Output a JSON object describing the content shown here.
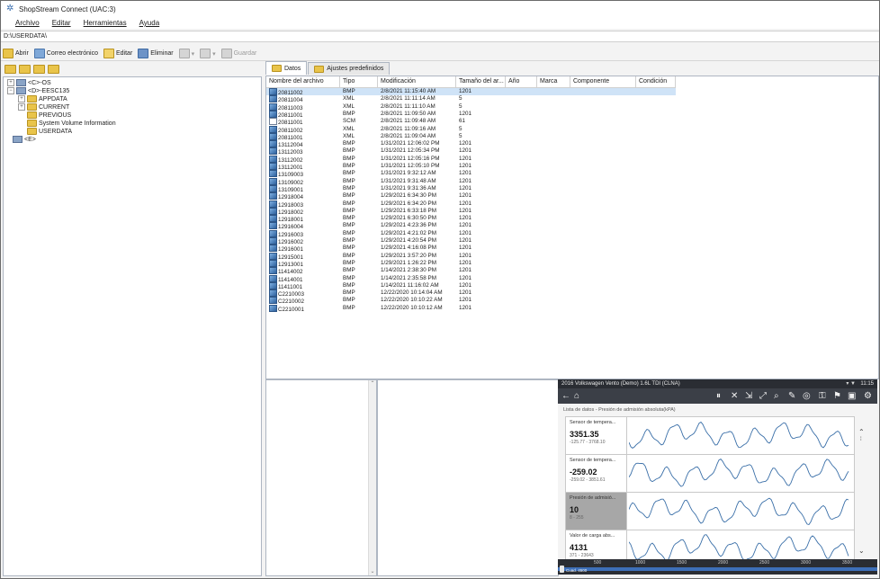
{
  "window": {
    "title": "ShopStream Connect (UAC:3)"
  },
  "menu": [
    "Archivo",
    "Editar",
    "Herramientas",
    "Ayuda"
  ],
  "path": "D:\\USERDATA\\",
  "toolbar": {
    "open": "Abrir",
    "email": "Correo electrónico",
    "edit": "Editar",
    "delete": "Eliminar",
    "save": "Guardar"
  },
  "tree": {
    "nodes": [
      "<C>-OS",
      "<D>-EESC135",
      "APPDATA",
      "CURRENT",
      "PREVIOUS",
      "System Volume Information",
      "USERDATA",
      "<E>"
    ]
  },
  "tabs": [
    "Datos",
    "Ajustes predefinidos"
  ],
  "files": {
    "columns": [
      "Nombre del archivo",
      "Tipo",
      "Modificación",
      "Tamaño del ar...",
      "Año",
      "Marca",
      "Componente",
      "Condición"
    ],
    "rows": [
      [
        "20811002",
        "BMP",
        "2/8/2021 11:15:40 AM",
        "1201"
      ],
      [
        "20811004",
        "XML",
        "2/8/2021 11:11:14 AM",
        "5"
      ],
      [
        "20811003",
        "XML",
        "2/8/2021 11:11:10 AM",
        "5"
      ],
      [
        "20811001",
        "BMP",
        "2/8/2021 11:09:50 AM",
        "1201"
      ],
      [
        "20811001",
        "SCM",
        "2/8/2021 11:09:48 AM",
        "61"
      ],
      [
        "20811002",
        "XML",
        "2/8/2021 11:09:16 AM",
        "5"
      ],
      [
        "20811001",
        "XML",
        "2/8/2021 11:09:04 AM",
        "5"
      ],
      [
        "13112004",
        "BMP",
        "1/31/2021 12:06:02 PM",
        "1201"
      ],
      [
        "13112003",
        "BMP",
        "1/31/2021 12:05:34 PM",
        "1201"
      ],
      [
        "13112002",
        "BMP",
        "1/31/2021 12:05:16 PM",
        "1201"
      ],
      [
        "13112001",
        "BMP",
        "1/31/2021 12:05:10 PM",
        "1201"
      ],
      [
        "13109003",
        "BMP",
        "1/31/2021 9:32:12 AM",
        "1201"
      ],
      [
        "13109002",
        "BMP",
        "1/31/2021 9:31:48 AM",
        "1201"
      ],
      [
        "13109001",
        "BMP",
        "1/31/2021 9:31:36 AM",
        "1201"
      ],
      [
        "12918004",
        "BMP",
        "1/29/2021 6:34:30 PM",
        "1201"
      ],
      [
        "12918003",
        "BMP",
        "1/29/2021 6:34:20 PM",
        "1201"
      ],
      [
        "12918002",
        "BMP",
        "1/29/2021 6:33:18 PM",
        "1201"
      ],
      [
        "12918001",
        "BMP",
        "1/29/2021 6:30:50 PM",
        "1201"
      ],
      [
        "12916004",
        "BMP",
        "1/29/2021 4:23:36 PM",
        "1201"
      ],
      [
        "12916003",
        "BMP",
        "1/29/2021 4:21:02 PM",
        "1201"
      ],
      [
        "12916002",
        "BMP",
        "1/29/2021 4:20:54 PM",
        "1201"
      ],
      [
        "12916001",
        "BMP",
        "1/29/2021 4:16:08 PM",
        "1201"
      ],
      [
        "12915001",
        "BMP",
        "1/29/2021 3:57:20 PM",
        "1201"
      ],
      [
        "12913001",
        "BMP",
        "1/29/2021 1:26:22 PM",
        "1201"
      ],
      [
        "11414002",
        "BMP",
        "1/14/2021 2:38:30 PM",
        "1201"
      ],
      [
        "11414001",
        "BMP",
        "1/14/2021 2:35:58 PM",
        "1201"
      ],
      [
        "11411001",
        "BMP",
        "1/14/2021 11:16:02 AM",
        "1201"
      ],
      [
        "C2210003",
        "BMP",
        "12/22/2020 10:14:04 AM",
        "1201"
      ],
      [
        "C2210002",
        "BMP",
        "12/22/2020 10:10:22 AM",
        "1201"
      ],
      [
        "C2210001",
        "BMP",
        "12/22/2020 10:10:12 AM",
        "1201"
      ]
    ]
  },
  "device": {
    "header": "2016 Volkswagen Vento (Demo) 1.6L TDI (CLNA)",
    "clock": "11:15",
    "subtitle": "Lista de datos - Presión de admisión absoluta(kPA)",
    "tracks": [
      {
        "name": "Sensor de tempera...",
        "value": "3351.35",
        "range": "-125.77 - 3768.10"
      },
      {
        "name": "Sensor de tempera...",
        "value": "-259.02",
        "range": "-259.02 - 3851.61"
      },
      {
        "name": "Presión de admisió...",
        "value": "10",
        "range": "8 - 255"
      },
      {
        "name": "Valor de carga abs...",
        "value": "4131",
        "range": "371 - 23643"
      }
    ],
    "axis_ticks": [
      "500",
      "1000",
      "1500",
      "2000",
      "2500",
      "3000",
      "3500"
    ],
    "cursor": "Cuad. 4500"
  }
}
